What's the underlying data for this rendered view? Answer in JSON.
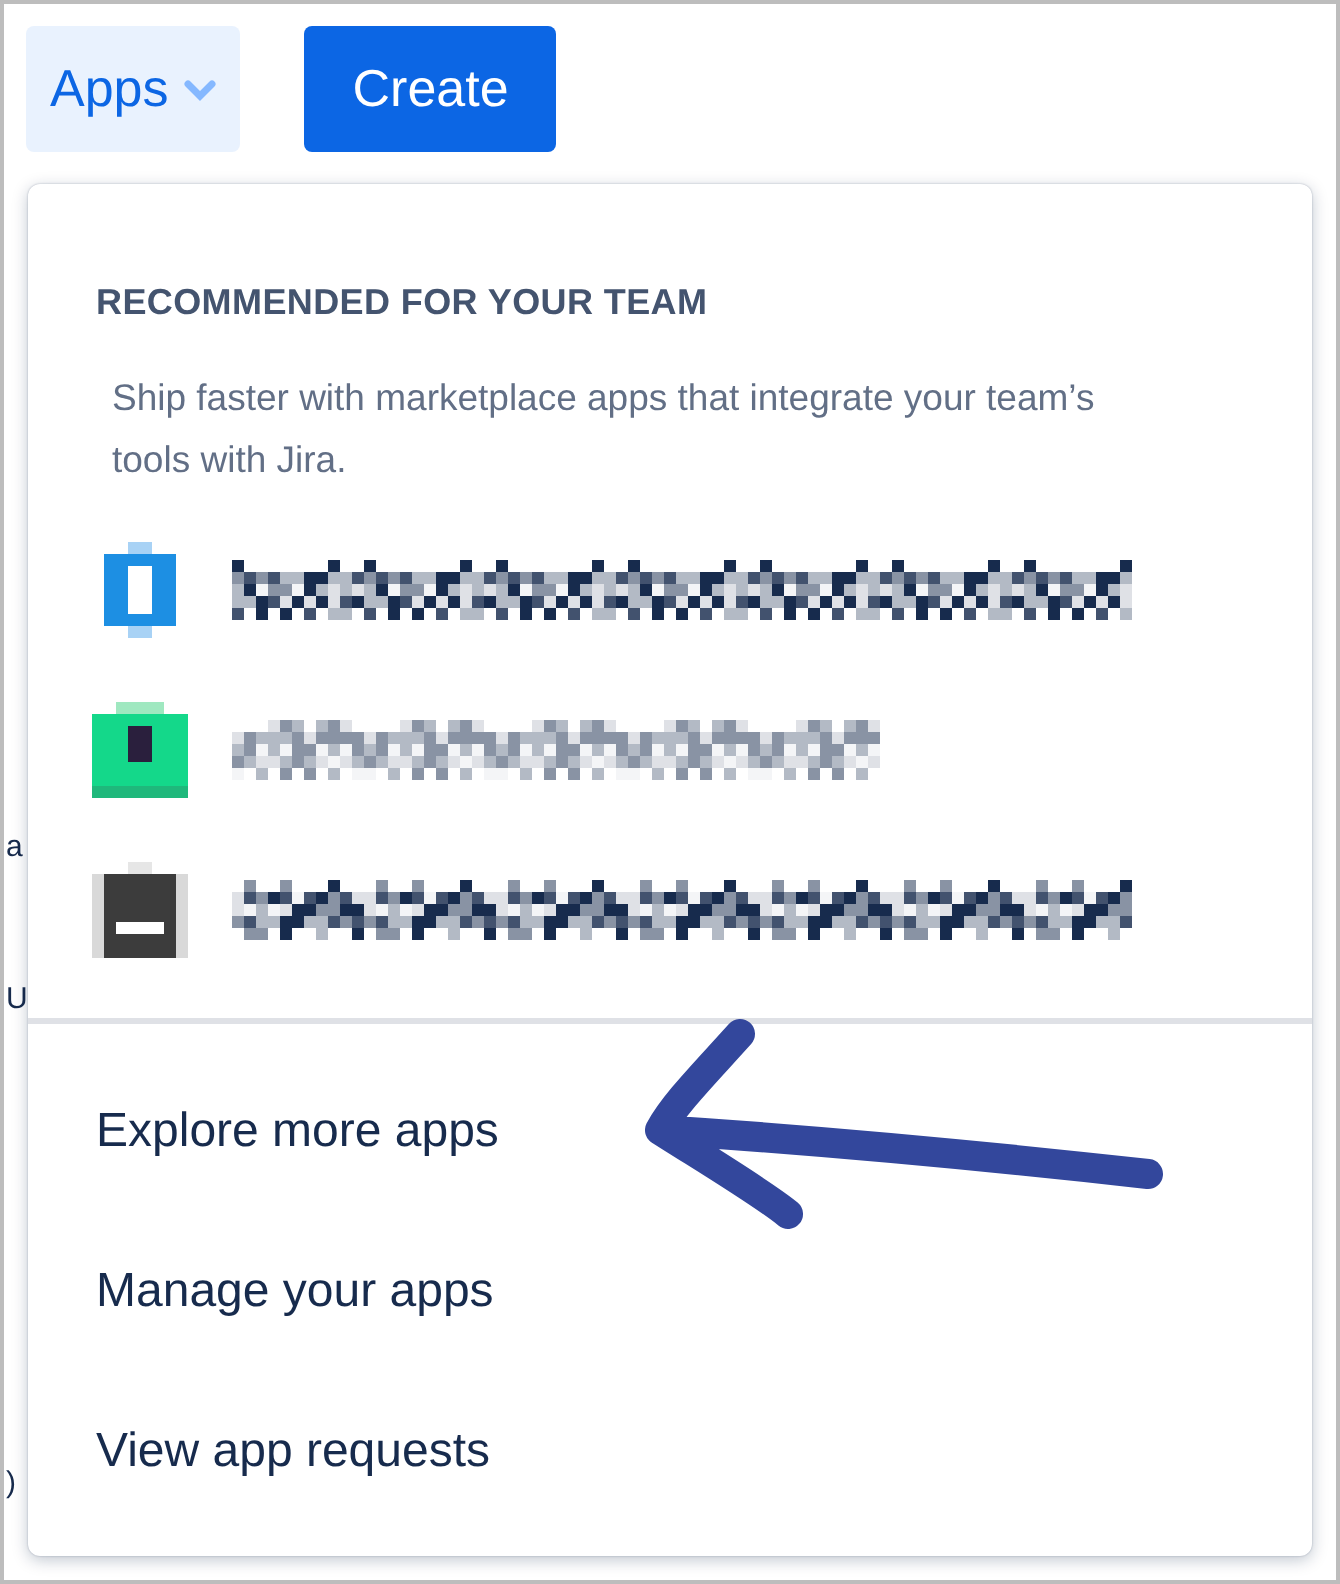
{
  "top_bar": {
    "apps_button": {
      "label": "Apps",
      "expanded": true
    },
    "create_button": {
      "label": "Create"
    }
  },
  "background_fragments": [
    "a",
    "U",
    ")"
  ],
  "apps_menu": {
    "heading": "RECOMMENDED FOR YOUR TEAM",
    "description": "Ship faster with marketplace apps that integrate your team’s tools with Jira.",
    "recommended_apps": [
      {
        "kind": "ring",
        "color": "#1d8fe3"
      },
      {
        "kind": "square",
        "color": "#14d88a"
      },
      {
        "kind": "bag",
        "color": "#3c3c3c"
      }
    ],
    "links": [
      "Explore more apps",
      "Manage your apps",
      "View app requests"
    ]
  },
  "annotations": [
    {
      "kind": "arrow",
      "color": "#33479c"
    }
  ]
}
